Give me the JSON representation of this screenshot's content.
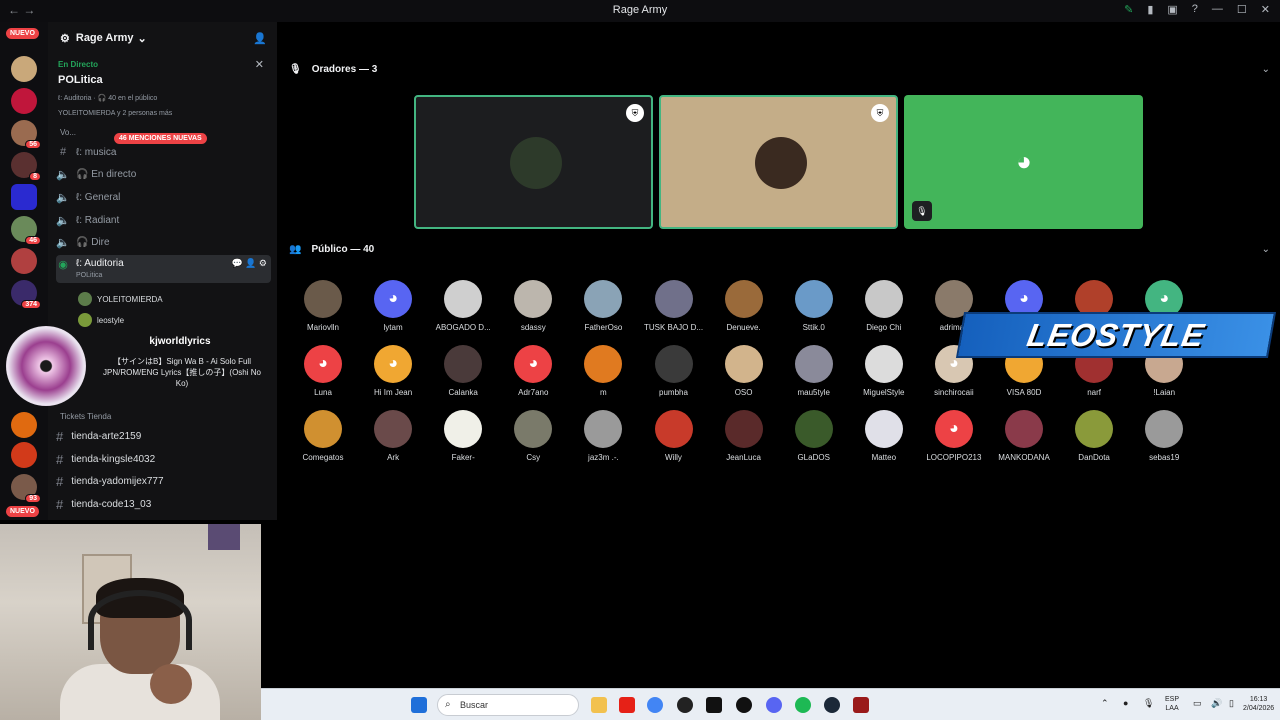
{
  "window": {
    "title": "Rage Army"
  },
  "servers": {
    "nuevo_label": "NUEVO",
    "badges": [
      "56",
      "8",
      "46",
      "374",
      "93"
    ]
  },
  "guild": {
    "name": "Rage Army"
  },
  "live": {
    "label": "En Directo",
    "title": "POLitica",
    "meta": "ℓ: Auditoria · 🎧 40 en el público",
    "people": "YOLEITOMIERDA y 2 personas más"
  },
  "channels": {
    "mentions_label": "46 MENCIONES NUEVAS",
    "voice_category": "Vo...",
    "items": [
      {
        "label": "ℓ: musica"
      },
      {
        "label": "🎧 En directo"
      },
      {
        "label": "ℓ: General"
      },
      {
        "label": "ℓ: Radiant"
      },
      {
        "label": "🎧 Dire"
      },
      {
        "label": "ℓ: Auditoria",
        "sub": "POLitica"
      }
    ],
    "members": [
      "YOLEITOMIERDA",
      "leostyle"
    ],
    "tickets_category": "Tickets Tienda",
    "text_channels": [
      "tienda-arte2159",
      "tienda-kingsle4032",
      "tienda-yadomijex777",
      "tienda-code13_03"
    ]
  },
  "music": {
    "channel": "kjworldlyrics",
    "song": "【サインはB】Sign Wa B - Ai Solo Full JPN/ROM/ENG Lyrics【推しの子】(Oshi No Ko)"
  },
  "stage": {
    "speakers_header": "Oradores — 3",
    "audience_header": "Público — 40",
    "audience": [
      "Mariovlln",
      "lytam",
      "ABOGADO D...",
      "sdassy",
      "FatherOso",
      "TUSK BAJO D...",
      "Denueve.",
      "Sttik.0",
      "Diego Chi",
      "adrimas",
      "",
      "",
      "",
      "Luna",
      "Hi Im Jean",
      "Calanka",
      "Adr7ano",
      "m",
      "pumbha",
      "OSO",
      "mau5tyle",
      "MiguelStyle",
      "sinchirocaii",
      "VISA 80D",
      "narf",
      "!Laian",
      "Comegatos",
      "Ark",
      "Faker-",
      "Csy",
      "jaz3m .-.",
      "Willy",
      "JeanLuca",
      "GLaDOS",
      "Matteo",
      "LOCOPIPO213",
      "MANKODANA",
      "DanDota",
      "sebas19"
    ]
  },
  "overlay": {
    "leostyle": "LEOSTYLE"
  },
  "taskbar": {
    "search_placeholder": "Buscar",
    "lang_top": "ESP",
    "lang_bottom": "LAA",
    "time": "16:13",
    "date": "2/04/2026"
  },
  "colors": {
    "discord_blurple": "#5865f2",
    "green": "#43b581",
    "red": "#ed4245",
    "orange": "#f0a732"
  }
}
